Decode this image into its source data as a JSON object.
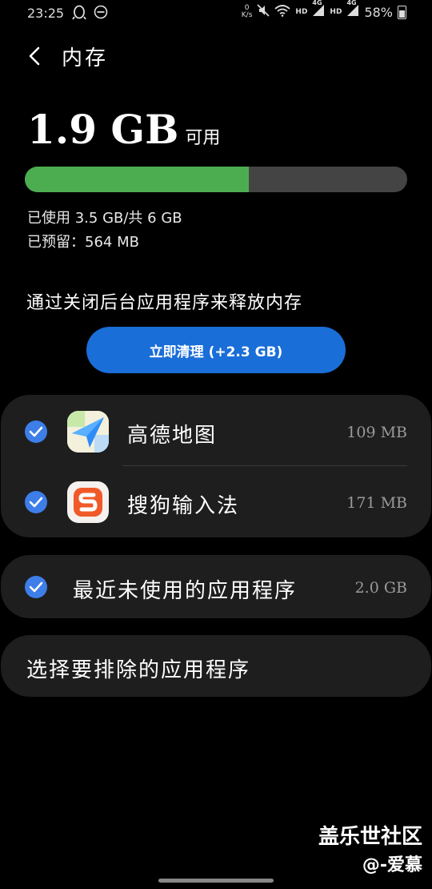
{
  "status": {
    "time": "23:25",
    "netspeed_value": "0",
    "netspeed_unit": "K/s",
    "hd1": "HD",
    "sig1": "4G",
    "hd2": "HD",
    "sig2": "4G",
    "battery": "58%"
  },
  "header": {
    "title": "内存"
  },
  "memory": {
    "available": "1.9 GB",
    "available_unit": "可用",
    "used_fraction": 0.585,
    "used_text": "已使用 3.5 GB/共 6 GB",
    "reserved_text": "已预留：564 MB",
    "bar_colors": {
      "used": "#4cad50",
      "free": "#444444"
    }
  },
  "hint": "通过关闭后台应用程序来释放内存",
  "clean_button": "立即清理 (+2.3 GB)",
  "apps": [
    {
      "name": "高德地图",
      "size": "109 MB",
      "icon": "amap-icon",
      "checked": true
    },
    {
      "name": "搜狗输入法",
      "size": "171 MB",
      "icon": "sogou-icon",
      "checked": true
    }
  ],
  "recent": {
    "label": "最近未使用的应用程序",
    "size": "2.0 GB",
    "checked": true
  },
  "exclude": {
    "label": "选择要排除的应用程序"
  },
  "watermark": {
    "line1": "盖乐世社区",
    "line2": "@-爱慕"
  },
  "colors": {
    "accent": "#1a6ed8",
    "check": "#3d7ee8",
    "card": "#1e1e1f"
  }
}
